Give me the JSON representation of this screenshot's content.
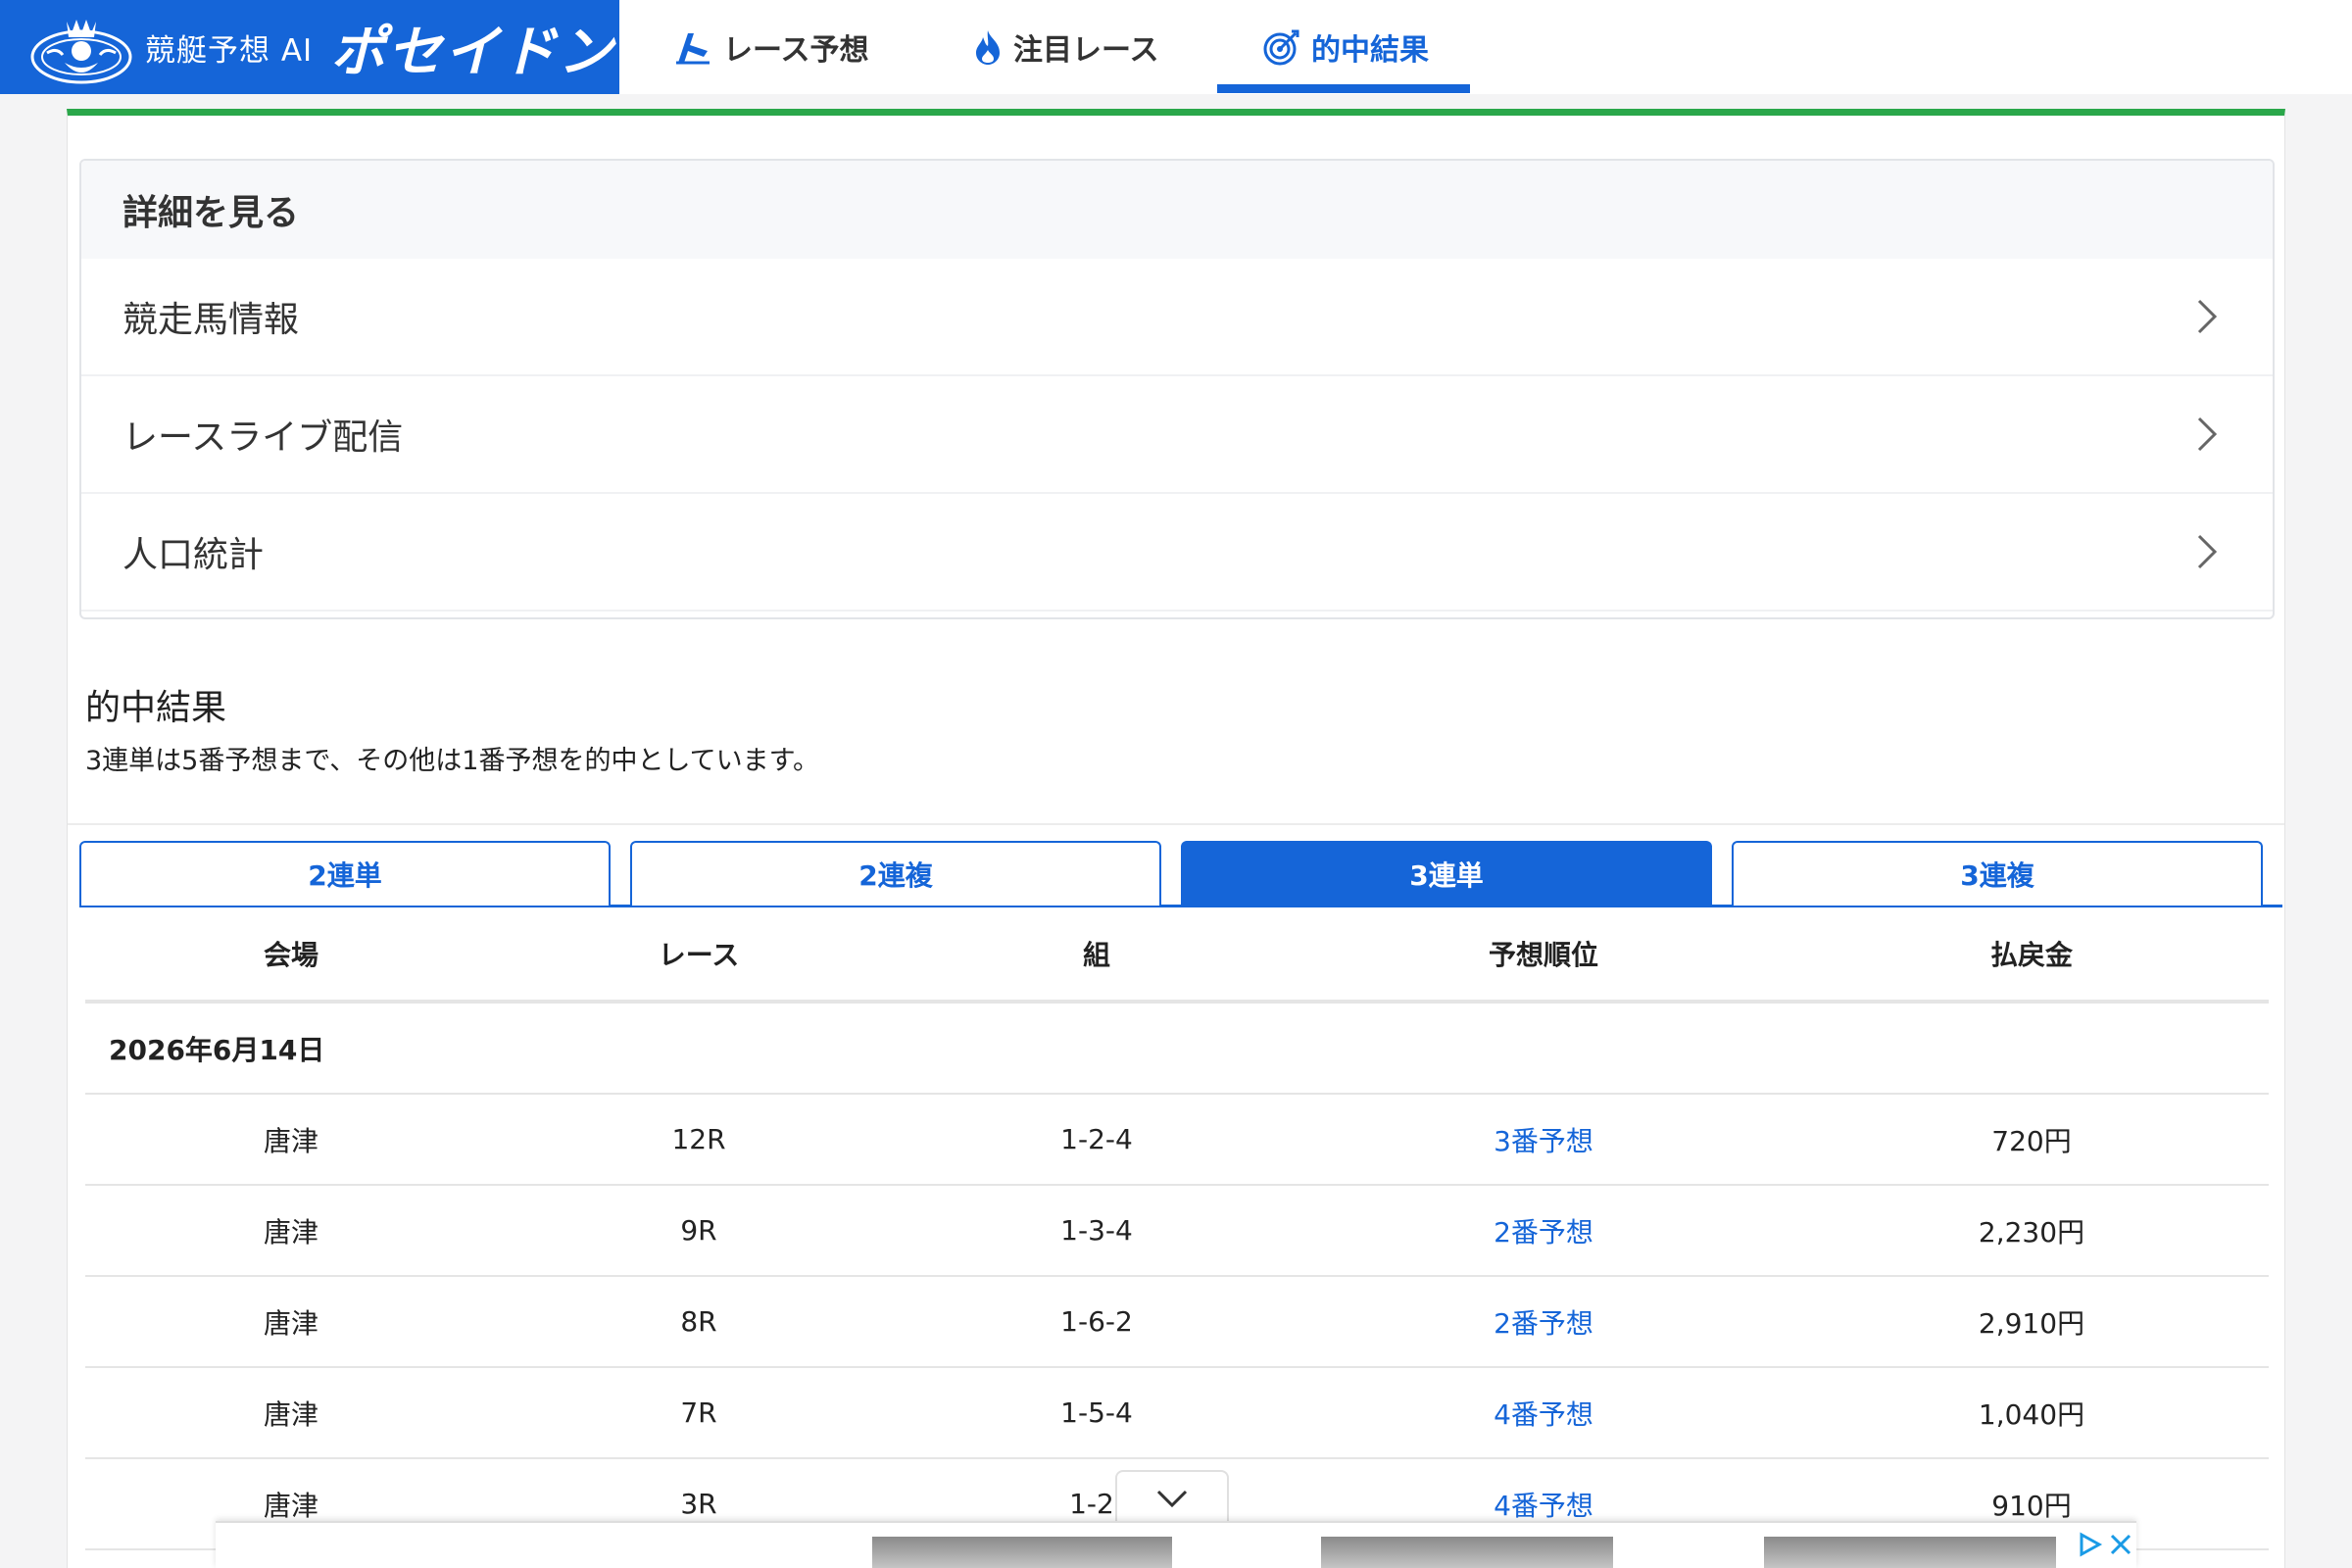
{
  "header": {
    "logo_sub": "競艇予想 AI",
    "logo_main": "ポセイドン",
    "nav": [
      {
        "label": "レース予想",
        "icon": "boat-flag-icon"
      },
      {
        "label": "注目レース",
        "icon": "fire-icon"
      },
      {
        "label": "的中結果",
        "icon": "target-icon",
        "active": true
      }
    ]
  },
  "details": {
    "title": "詳細を見る",
    "items": [
      "競走馬情報",
      "レースライブ配信",
      "人口統計"
    ]
  },
  "results": {
    "title": "的中結果",
    "note": "3連単は5番予想まで、その他は1番予想を的中としています。",
    "tabs": [
      {
        "label": "2連単"
      },
      {
        "label": "2連複"
      },
      {
        "label": "3連単",
        "active": true
      },
      {
        "label": "3連複"
      }
    ],
    "columns": [
      "会場",
      "レース",
      "組",
      "予想順位",
      "払戻金"
    ],
    "date": "2026年6月14日",
    "rows": [
      {
        "venue": "唐津",
        "race": "12R",
        "combo": "1-2-4",
        "rank": "3番予想",
        "payout": "720円"
      },
      {
        "venue": "唐津",
        "race": "9R",
        "combo": "1-3-4",
        "rank": "2番予想",
        "payout": "2,230円"
      },
      {
        "venue": "唐津",
        "race": "8R",
        "combo": "1-6-2",
        "rank": "2番予想",
        "payout": "2,910円"
      },
      {
        "venue": "唐津",
        "race": "7R",
        "combo": "1-5-4",
        "rank": "4番予想",
        "payout": "1,040円"
      },
      {
        "venue": "唐津",
        "race": "3R",
        "combo": "1-2-",
        "rank": "4番予想",
        "payout": "910円"
      }
    ]
  },
  "colors": {
    "brand_blue": "#1565d8",
    "accent_green": "#2aa74a"
  }
}
